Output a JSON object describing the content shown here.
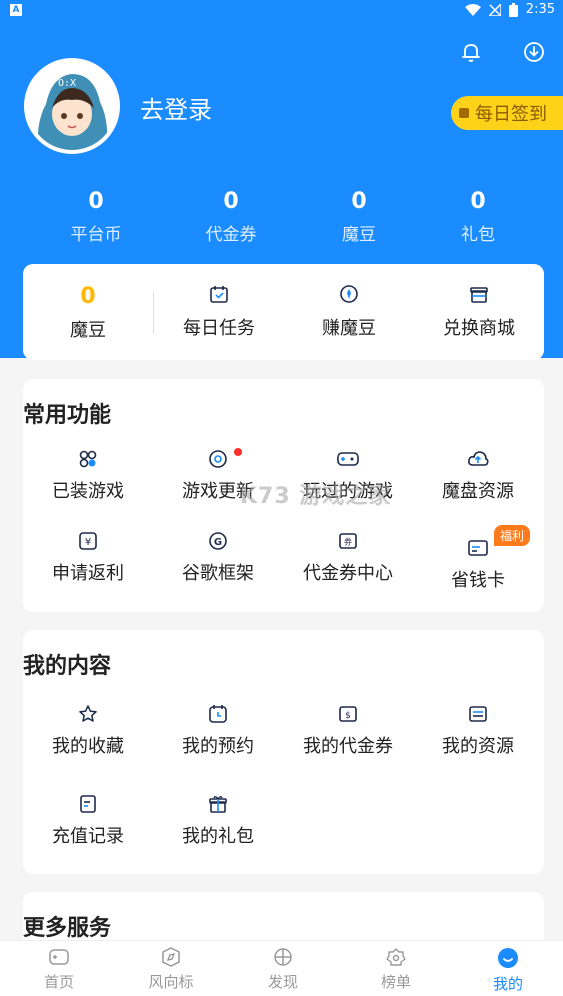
{
  "status_bar": {
    "time": "2:35",
    "left_badge": "A"
  },
  "profile": {
    "login_text": "去登录",
    "sign_in": "每日签到"
  },
  "stats": [
    {
      "value": "0",
      "label": "平台币"
    },
    {
      "value": "0",
      "label": "代金券"
    },
    {
      "value": "0",
      "label": "魔豆"
    },
    {
      "value": "0",
      "label": "礼包"
    }
  ],
  "bean_card": {
    "value": "0",
    "label": "魔豆",
    "items": [
      {
        "label": "每日任务",
        "icon": "calendar-check-icon"
      },
      {
        "label": "赚魔豆",
        "icon": "coin-icon"
      },
      {
        "label": "兑换商城",
        "icon": "gift-box-icon"
      }
    ]
  },
  "common": {
    "title": "常用功能",
    "items": [
      {
        "label": "已装游戏",
        "icon": "apps-icon"
      },
      {
        "label": "游戏更新",
        "icon": "refresh-icon"
      },
      {
        "label": "玩过的游戏",
        "icon": "gamepad-icon"
      },
      {
        "label": "魔盘资源",
        "icon": "cloud-upload-icon"
      },
      {
        "label": "申请返利",
        "icon": "yuan-icon"
      },
      {
        "label": "谷歌框架",
        "icon": "google-icon"
      },
      {
        "label": "代金券中心",
        "icon": "voucher-icon"
      },
      {
        "label": "省钱卡",
        "icon": "card-icon"
      }
    ],
    "badge": "福利"
  },
  "content": {
    "title": "我的内容",
    "items": [
      {
        "label": "我的收藏",
        "icon": "star-icon"
      },
      {
        "label": "我的预约",
        "icon": "clock-icon"
      },
      {
        "label": "我的代金券",
        "icon": "voucher-icon"
      },
      {
        "label": "我的资源",
        "icon": "folder-icon"
      },
      {
        "label": "充值记录",
        "icon": "record-icon"
      },
      {
        "label": "我的礼包",
        "icon": "gift-icon"
      }
    ]
  },
  "more": {
    "title": "更多服务"
  },
  "watermark": "K73 游戏之家",
  "tabs": [
    {
      "label": "首页",
      "icon": "home-gamepad-icon"
    },
    {
      "label": "风向标",
      "icon": "compass-icon"
    },
    {
      "label": "发现",
      "icon": "discover-icon"
    },
    {
      "label": "榜单",
      "icon": "rank-icon"
    },
    {
      "label": "我的",
      "icon": "profile-icon",
      "active": true
    }
  ],
  "colors": {
    "primary": "#1a8cff",
    "gold": "#ffd21a",
    "bean": "#ffb800",
    "badge": "#ff7a1a"
  }
}
